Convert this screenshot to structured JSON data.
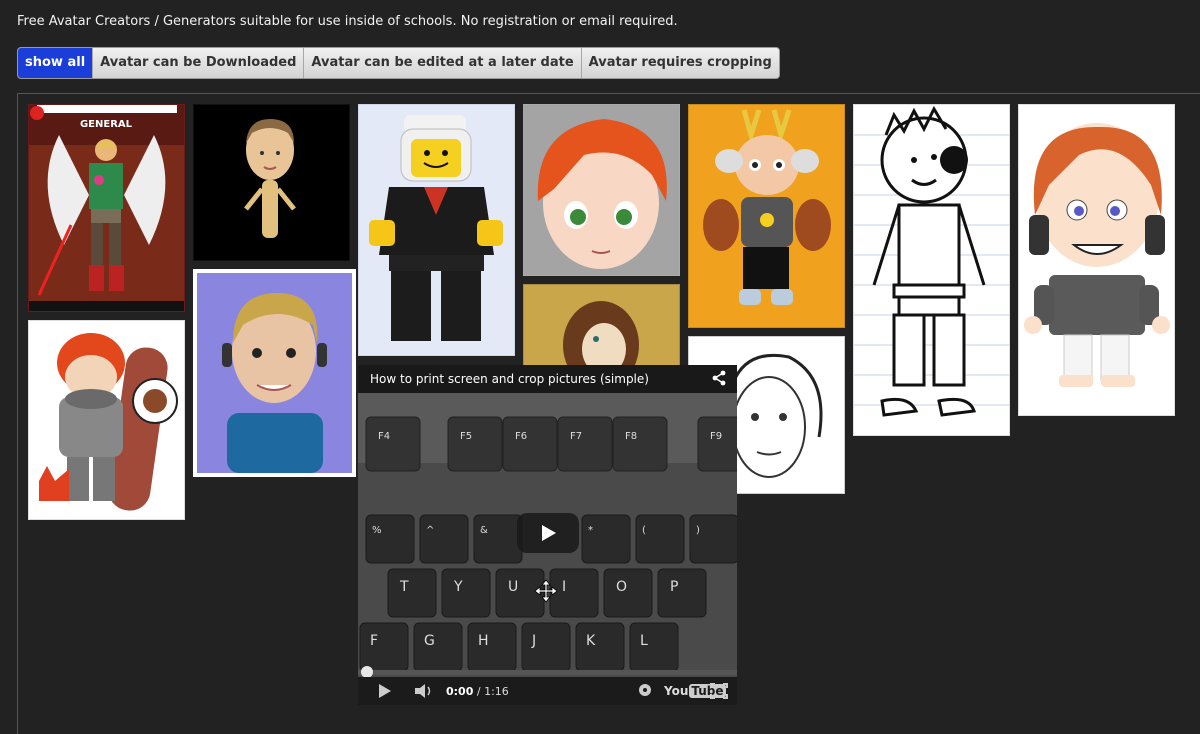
{
  "page": {
    "intro": "Free Avatar Creators / Generators suitable for use inside of schools. No registration or email required."
  },
  "filters": [
    {
      "label": "show all",
      "active": true
    },
    {
      "label": "Avatar can be Downloaded",
      "active": false
    },
    {
      "label": "Avatar can be edited at a later date",
      "active": false
    },
    {
      "label": "Avatar requires cropping",
      "active": false
    }
  ],
  "gallery": {
    "comic_cover_title": "GENERAL"
  },
  "video": {
    "title": "How to print screen and crop pictures (simple)",
    "time_current": "0:00",
    "time_separator": " / ",
    "time_total": "1:16",
    "logo_you": "You",
    "logo_tube": "Tube",
    "progress": 0.0,
    "key_labels_fn": [
      "F4",
      "F5",
      "F6",
      "F7",
      "F8",
      "F9"
    ],
    "key_labels_num": [
      "%",
      "^",
      "&",
      "*",
      "(",
      ")"
    ],
    "key_labels_row": [
      "T",
      "Y",
      "U",
      "I",
      "O",
      "P"
    ],
    "key_labels_row2": [
      "F",
      "G",
      "H",
      "J",
      "K",
      "L"
    ]
  },
  "colors": {
    "accent": "#1c3ed8",
    "background": "#222222"
  }
}
